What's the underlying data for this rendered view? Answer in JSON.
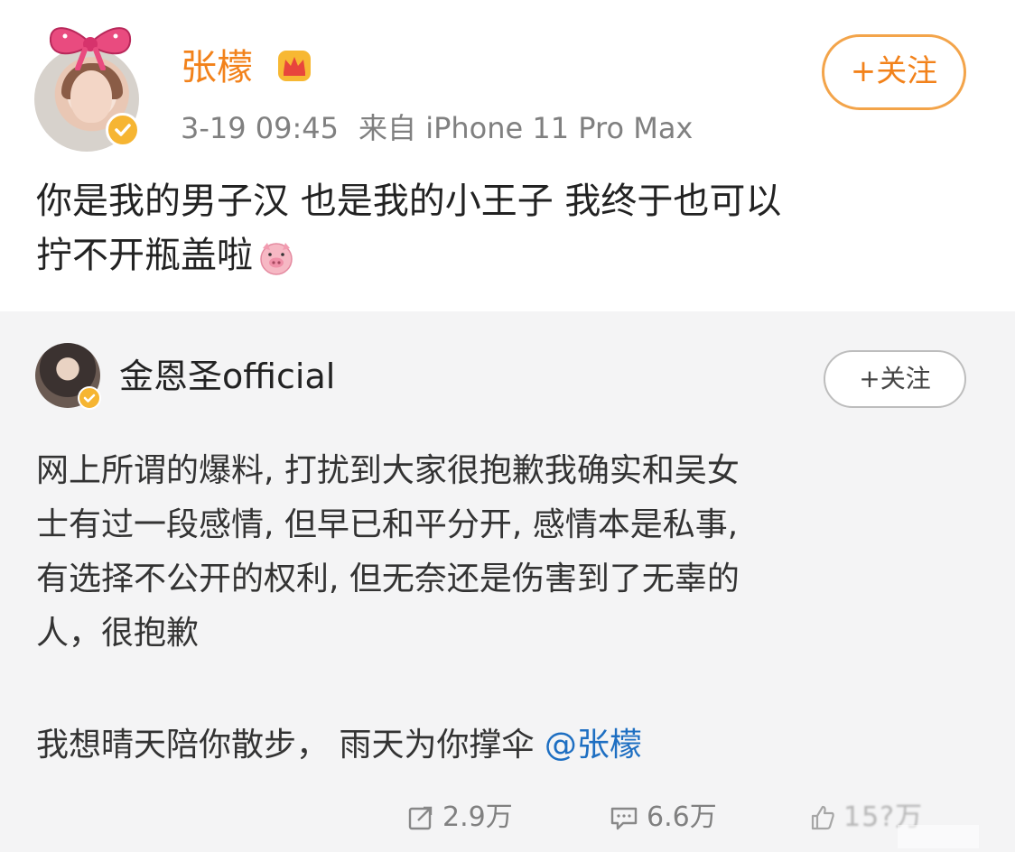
{
  "post": {
    "author": "张檬",
    "follow_label": "+关注",
    "time": "3-19 09:45",
    "source": "来自 iPhone 11 Pro Max",
    "text_line1": "你是我的男子汉  也是我的小王子  我终于也可以",
    "text_line2": "拧不开瓶盖啦",
    "icons": {
      "avatar": "avatar-icon",
      "verified": "verified-badge-icon",
      "vip": "crown-icon",
      "emoji": "pig-emoji-icon"
    },
    "name_color": "#f2821b"
  },
  "repost": {
    "author": "金恩圣official",
    "follow_label": "+关注",
    "paragraph_lines": [
      "网上所谓的爆料, 打扰到大家很抱歉我确实和吴女",
      "士有过一段感情, 但早已和平分开, 感情本是私事,",
      "有选择不公开的权利, 但无奈还是伤害到了无辜的",
      "人，很抱歉"
    ],
    "quote_text": "我想晴天陪你散步，  雨天为你撑伞 ",
    "mention": "@张檬",
    "mention_color": "#1e6fc2"
  },
  "actions": {
    "share_count": "2.9万",
    "comment_count": "6.6万",
    "like_count": "15?万"
  }
}
